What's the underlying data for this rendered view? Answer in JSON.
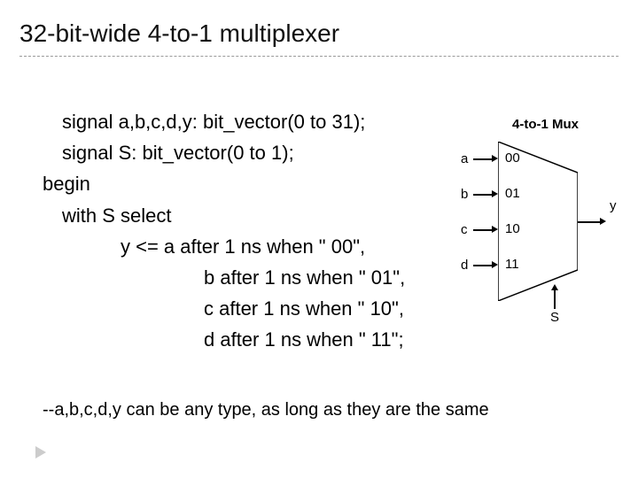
{
  "title": "32-bit-wide 4-to-1 multiplexer",
  "code": {
    "l1": "signal a,b,c,d,y: bit_vector(0 to 31);",
    "l2": "signal S: bit_vector(0 to 1);",
    "l3": "begin",
    "l4": "with S select",
    "l5": "y <=   a after 1 ns when \" 00\",",
    "l6": "b after 1 ns when \" 01\",",
    "l7": "c after 1 ns when \" 10\",",
    "l8": "d after 1 ns when \" 11\";"
  },
  "footnote": "--a,b,c,d,y can be any type, as long as they are the same",
  "mux": {
    "title": "4-to-1 Mux",
    "in": [
      "a",
      "b",
      "c",
      "d"
    ],
    "sel": [
      "00",
      "01",
      "10",
      "11"
    ],
    "out": "y",
    "select_label": "S"
  }
}
